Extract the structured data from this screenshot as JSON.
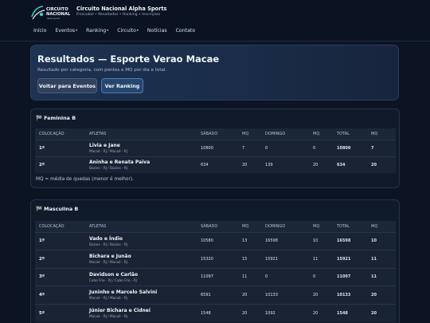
{
  "header": {
    "brand_name": "Circuito Nacional Alpha Sports",
    "brand_tagline": "Frescobol • Resultados • Ranking • Inscrições",
    "logo_line1": "CIRCUITO",
    "logo_line2": "NACIONAL",
    "logo_line3": "alpha sports"
  },
  "nav": {
    "items": [
      {
        "label": "Início",
        "dropdown": false
      },
      {
        "label": "Eventos",
        "dropdown": true
      },
      {
        "label": "Ranking",
        "dropdown": true
      },
      {
        "label": "Circuito",
        "dropdown": true
      },
      {
        "label": "Notícias",
        "dropdown": false
      },
      {
        "label": "Contato",
        "dropdown": false
      }
    ],
    "caret": "▾"
  },
  "hero": {
    "title": "Resultados — Esporte Verao Macae",
    "subtitle": "Resultado por categoria, com pontos e MQ por dia e total.",
    "back_button": "Voltar para Eventos",
    "ranking_button": "Ver Ranking"
  },
  "table_headers": {
    "position": "COLOCAÇÃO",
    "athletes": "ATLETAS",
    "saturday": "SÁBADO",
    "mq1": "MQ",
    "sunday": "DOMINGO",
    "mq2": "MQ",
    "total": "TOTAL",
    "mq_total": "MQ"
  },
  "categories": [
    {
      "title": "Feminina B",
      "flag_icon": "🏁",
      "rows": [
        {
          "position": "1º",
          "athletes": "Livia e Jane",
          "cities": "Macaé - RJ / Macaé - RJ",
          "saturday": "10800",
          "mq1": "7",
          "sunday": "0",
          "mq2": "0",
          "total": "10800",
          "mq_total": "7"
        },
        {
          "position": "2º",
          "athletes": "Aninha e Renata Paiva",
          "cities": "Búzios - RJ / Búzios - RJ",
          "saturday": "634",
          "mq1": "20",
          "sunday": "139",
          "mq2": "20",
          "total": "634",
          "mq_total": "20"
        }
      ],
      "note": "MQ = média de quedas (menor é melhor)."
    },
    {
      "title": "Masculina B",
      "flag_icon": "🏁",
      "rows": [
        {
          "position": "1º",
          "athletes": "Vado e Índio",
          "cities": "Búzios - RJ / Búzios - RJ",
          "saturday": "10580",
          "mq1": "13",
          "sunday": "16598",
          "mq2": "10",
          "total": "16598",
          "mq_total": "10"
        },
        {
          "position": "2º",
          "athletes": "Bichara e Junão",
          "cities": "Macaé - RJ / Macaé - RJ",
          "saturday": "15320",
          "mq1": "15",
          "sunday": "15921",
          "mq2": "11",
          "total": "15921",
          "mq_total": "11"
        },
        {
          "position": "3º",
          "athletes": "Davidson e Carlão",
          "cities": "Cabo Frio - RJ / Cabo Frio - RJ",
          "saturday": "11097",
          "mq1": "11",
          "sunday": "0",
          "mq2": "0",
          "total": "11097",
          "mq_total": "11"
        },
        {
          "position": "4º",
          "athletes": "Juninho e Marcelo Salvini",
          "cities": "Macaé - RJ / Macaé - RJ",
          "saturday": "6591",
          "mq1": "20",
          "sunday": "10133",
          "mq2": "20",
          "total": "10133",
          "mq_total": "20"
        },
        {
          "position": "5º",
          "athletes": "Júnior Bichara e Cidnei",
          "cities": "Macaé - RJ / Macaé - RJ",
          "saturday": "1548",
          "mq1": "20",
          "sunday": "1092",
          "mq2": "20",
          "total": "1548",
          "mq_total": "20"
        }
      ]
    }
  ]
}
